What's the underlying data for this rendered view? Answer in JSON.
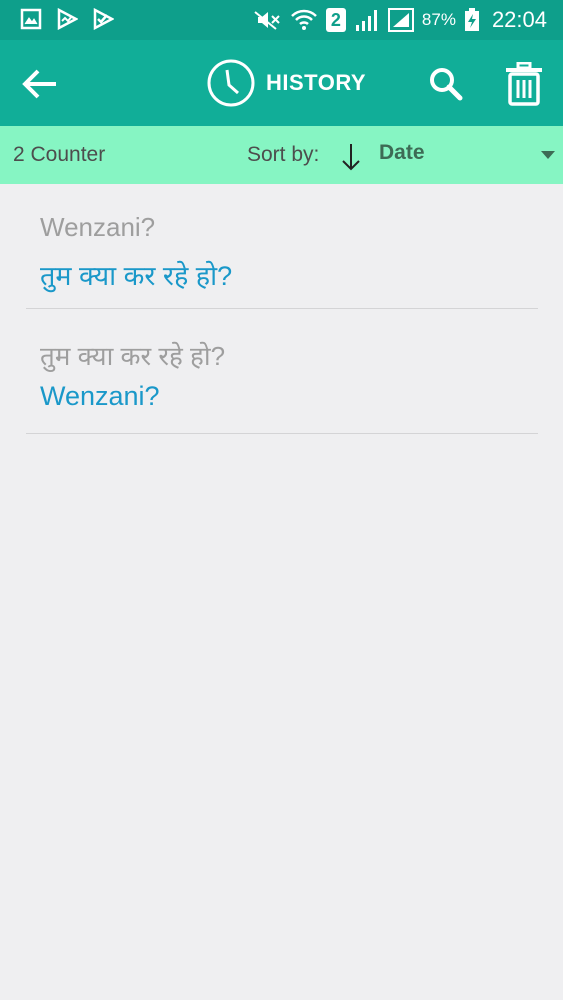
{
  "statusbar": {
    "sim_slot": "2",
    "battery": "87%",
    "time": "22:04"
  },
  "appbar": {
    "title": "HISTORY"
  },
  "sortbar": {
    "counter": "2 Counter",
    "sort_label": "Sort by:",
    "sort_value": "Date"
  },
  "history": [
    {
      "source": "Wenzani?",
      "translation": "तुम क्या कर रहे हो?"
    },
    {
      "source": "तुम क्या कर रहे हो?",
      "translation": "Wenzani?"
    }
  ],
  "colors": {
    "statusbar": "#0e9f8b",
    "appbar": "#11ae98",
    "sortbar": "#86f5c3",
    "translation_text": "#1a98c9",
    "source_text": "#9e9e9e"
  },
  "icons": [
    "gallery-icon",
    "play-store-icon",
    "download-check-icon",
    "mute-icon",
    "wifi-icon",
    "signal-icon",
    "battery-icon",
    "back-arrow-icon",
    "clock-icon",
    "search-icon",
    "trash-icon",
    "sort-arrow-icon",
    "dropdown-icon"
  ]
}
